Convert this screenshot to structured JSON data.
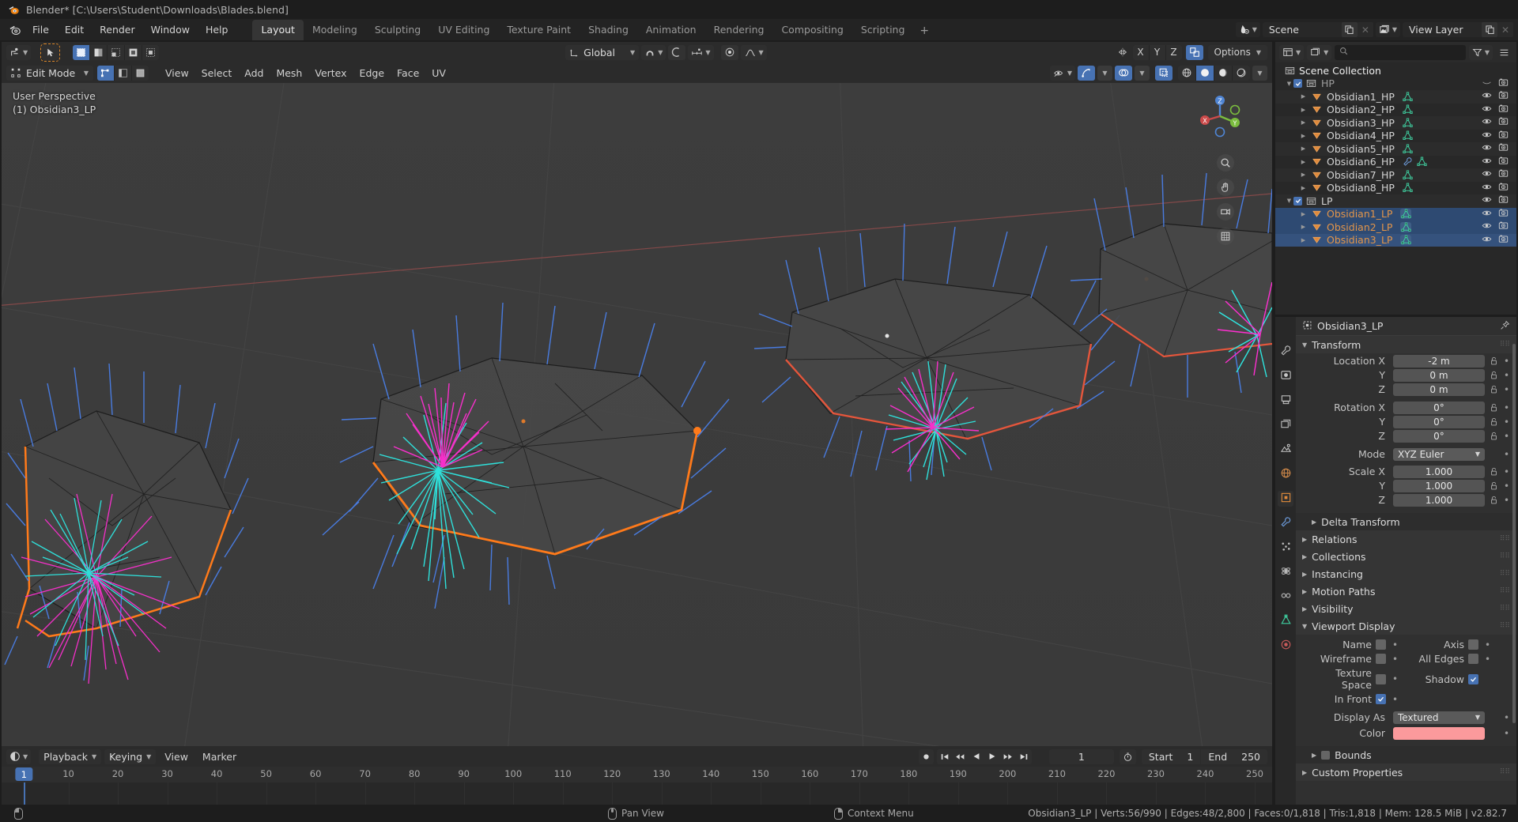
{
  "titlebar": {
    "title": "Blender* [C:\\Users\\Student\\Downloads\\Blades.blend]",
    "logo_icon": "blender-logo-icon"
  },
  "topbar": {
    "menus": [
      "File",
      "Edit",
      "Render",
      "Window",
      "Help"
    ],
    "tabs": [
      "Layout",
      "Modeling",
      "Sculpting",
      "UV Editing",
      "Texture Paint",
      "Shading",
      "Animation",
      "Rendering",
      "Compositing",
      "Scripting"
    ],
    "active_tab": "Layout",
    "add_tab_label": "+",
    "scene_name": "Scene",
    "view_layer_name": "View Layer",
    "scene_icon": "scene-icon",
    "view_layer_icon": "view-layer-icon",
    "new_icon": "duplicate-icon",
    "remove_icon": "close-icon"
  },
  "viewport": {
    "header_row1": {
      "editor_type_icon": "editor-type-icon",
      "select_tool_icon": "tweak-tool-icon",
      "select_modes": [
        "set",
        "extend",
        "subtract",
        "invert",
        "intersect"
      ],
      "transform_orientation": "Global",
      "orientation_icon": "orientation-icon",
      "snap_icon": "snap-magnet-icon",
      "snap_target_icon": "snap-increment-icon",
      "proportional_icon": "proportional-edit-icon",
      "falloff_icon": "smooth-falloff-icon",
      "mirror_label": "Mirror",
      "mirror_axes": [
        "X",
        "Y",
        "Z"
      ],
      "xray_icon": "toggle-xray-icon",
      "options_label": "Options"
    },
    "header_row2": {
      "mode": "Edit Mode",
      "mode_icon": "edit-mode-icon",
      "mesh_select_modes": [
        "vertex-select-icon",
        "edge-select-icon",
        "face-select-icon"
      ],
      "menus": [
        "View",
        "Select",
        "Add",
        "Mesh",
        "Vertex",
        "Edge",
        "Face",
        "UV"
      ],
      "visibility_icon": "visibility-icon",
      "gizmo_icon": "gizmo-icon",
      "overlays_icon": "overlays-icon",
      "xray_icon": "xray-icon",
      "shading_modes": [
        "wireframe-shading-icon",
        "solid-shading-icon",
        "material-preview-icon",
        "rendered-shading-icon"
      ]
    },
    "overlay": {
      "view_name": "User Perspective",
      "active_object": "(1) Obsidian3_LP"
    },
    "gizmo": {
      "axes": [
        "X",
        "Y",
        "Z"
      ]
    },
    "nav_icons": [
      "zoom-icon",
      "pan-hand-icon",
      "camera-view-icon",
      "ortho-persp-icon"
    ]
  },
  "timeline": {
    "editor_icon": "timeline-editor-icon",
    "menus": [
      "Playback",
      "Keying",
      "View",
      "Marker"
    ],
    "record_icon": "auto-keying-icon",
    "transport_icons": [
      "jump-start-icon",
      "prev-keyframe-icon",
      "play-reverse-icon",
      "play-icon",
      "next-keyframe-icon",
      "jump-end-icon"
    ],
    "current_frame": "1",
    "use_preview_icon": "stopwatch-icon",
    "start_label": "Start",
    "start_value": "1",
    "end_label": "End",
    "end_value": "250",
    "ruler_ticks": [
      "10",
      "20",
      "30",
      "40",
      "50",
      "60",
      "70",
      "80",
      "90",
      "100",
      "110",
      "120",
      "130",
      "140",
      "150",
      "160",
      "170",
      "180",
      "190",
      "200",
      "210",
      "220",
      "230",
      "240",
      "250"
    ],
    "playhead_label": "1"
  },
  "outliner": {
    "editor_icon": "outliner-editor-icon",
    "display_mode_icon": "view-layer-icon",
    "search_placeholder": "",
    "search_icon": "search-icon",
    "filter_icon": "filter-icon",
    "root": "Scene Collection",
    "root_icon": "collection-icon",
    "rows": [
      {
        "name": "HP",
        "type": "collection",
        "indent": 0,
        "expanded": true,
        "checkbox": true,
        "dim": true,
        "selected": false,
        "hide_icon": "closed-eye-icon",
        "render_icon": "camera-icon"
      },
      {
        "name": "Obsidian1_HP",
        "type": "object",
        "indent": 1,
        "expanded": false,
        "selected": false,
        "mesh_icon": "mesh-data-icon",
        "hide_icon": "eye-icon",
        "render_icon": "camera-icon"
      },
      {
        "name": "Obsidian2_HP",
        "type": "object",
        "indent": 1,
        "expanded": false,
        "selected": false,
        "mesh_icon": "mesh-data-icon",
        "hide_icon": "eye-icon",
        "render_icon": "camera-icon"
      },
      {
        "name": "Obsidian3_HP",
        "type": "object",
        "indent": 1,
        "expanded": false,
        "selected": false,
        "mesh_icon": "mesh-data-icon",
        "hide_icon": "eye-icon",
        "render_icon": "camera-icon"
      },
      {
        "name": "Obsidian4_HP",
        "type": "object",
        "indent": 1,
        "expanded": false,
        "selected": false,
        "mesh_icon": "mesh-data-icon",
        "hide_icon": "eye-icon",
        "render_icon": "camera-icon"
      },
      {
        "name": "Obsidian5_HP",
        "type": "object",
        "indent": 1,
        "expanded": false,
        "selected": false,
        "mesh_icon": "mesh-data-icon",
        "hide_icon": "eye-icon",
        "render_icon": "camera-icon"
      },
      {
        "name": "Obsidian6_HP",
        "type": "object",
        "indent": 1,
        "expanded": false,
        "selected": false,
        "modifier_icon": "wrench-modifier-icon",
        "mesh_icon": "mesh-data-icon",
        "hide_icon": "eye-icon",
        "render_icon": "camera-icon"
      },
      {
        "name": "Obsidian7_HP",
        "type": "object",
        "indent": 1,
        "expanded": false,
        "selected": false,
        "mesh_icon": "mesh-data-icon",
        "hide_icon": "eye-icon",
        "render_icon": "camera-icon"
      },
      {
        "name": "Obsidian8_HP",
        "type": "object",
        "indent": 1,
        "expanded": false,
        "selected": false,
        "mesh_icon": "mesh-data-icon",
        "hide_icon": "eye-icon",
        "render_icon": "camera-icon"
      },
      {
        "name": "LP",
        "type": "collection",
        "indent": 0,
        "expanded": true,
        "checkbox": true,
        "selected": false,
        "hide_icon": "eye-icon",
        "render_icon": "camera-icon"
      },
      {
        "name": "Obsidian1_LP",
        "type": "object",
        "indent": 1,
        "expanded": false,
        "selected": true,
        "mesh_icon": "mesh-data-icon",
        "hide_icon": "eye-icon",
        "render_icon": "camera-icon"
      },
      {
        "name": "Obsidian2_LP",
        "type": "object",
        "indent": 1,
        "expanded": false,
        "selected": true,
        "mesh_icon": "mesh-data-icon",
        "hide_icon": "eye-icon",
        "render_icon": "camera-icon"
      },
      {
        "name": "Obsidian3_LP",
        "type": "object",
        "indent": 1,
        "expanded": false,
        "selected": true,
        "active": true,
        "mesh_icon": "mesh-data-icon",
        "hide_icon": "eye-icon",
        "render_icon": "camera-icon"
      }
    ]
  },
  "properties": {
    "tabs": [
      "tool-icon",
      "render-icon",
      "output-icon",
      "view-layer-icon",
      "scene-icon",
      "world-icon",
      "object-icon",
      "modifier-icon",
      "particles-icon",
      "physics-icon",
      "constraint-icon",
      "data-icon",
      "material-icon"
    ],
    "active_tab_index": 6,
    "breadcrumb": "Obsidian3_LP",
    "breadcrumb_icon": "object-icon",
    "pin_icon": "pin-icon",
    "transform": {
      "title": "Transform",
      "rows": [
        {
          "label": "Location X",
          "value": "-2 m"
        },
        {
          "label": "Y",
          "value": "0 m"
        },
        {
          "label": "Z",
          "value": "0 m"
        },
        {
          "label": "Rotation X",
          "value": "0°"
        },
        {
          "label": "Y",
          "value": "0°"
        },
        {
          "label": "Z",
          "value": "0°"
        }
      ],
      "mode_label": "Mode",
      "mode_value": "XYZ Euler",
      "scale_rows": [
        {
          "label": "Scale X",
          "value": "1.000"
        },
        {
          "label": "Y",
          "value": "1.000"
        },
        {
          "label": "Z",
          "value": "1.000"
        }
      ]
    },
    "panels": [
      "Delta Transform",
      "Relations",
      "Collections",
      "Instancing",
      "Motion Paths",
      "Visibility"
    ],
    "viewport_display": {
      "title": "Viewport Display",
      "toggles_left": [
        {
          "label": "Name",
          "checked": false
        },
        {
          "label": "Wireframe",
          "checked": false
        },
        {
          "label": "Texture Space",
          "checked": false
        },
        {
          "label": "In Front",
          "checked": true
        }
      ],
      "toggles_right": [
        {
          "label": "Axis",
          "checked": false
        },
        {
          "label": "All Edges",
          "checked": false
        },
        {
          "label": "Shadow",
          "checked": true
        }
      ],
      "display_as_label": "Display As",
      "display_as_value": "Textured",
      "color_label": "Color",
      "color_value": "#fb9a9c",
      "bounds_label": "Bounds",
      "bounds_checked": false
    },
    "custom_properties": "Custom Properties"
  },
  "statusbar": {
    "left_hint_icon": "mouse-left-icon",
    "middle_hint_icon": "mouse-middle-icon",
    "middle_hint": "Pan View",
    "right_hint_icon": "mouse-right-icon",
    "right_hint": "Context Menu",
    "stats": "Obsidian3_LP | Verts:56/990 | Edges:48/2,800 | Faces:0/1,818 | Tris:1,818 | Mem: 128.5 MiB | v2.82.7"
  }
}
